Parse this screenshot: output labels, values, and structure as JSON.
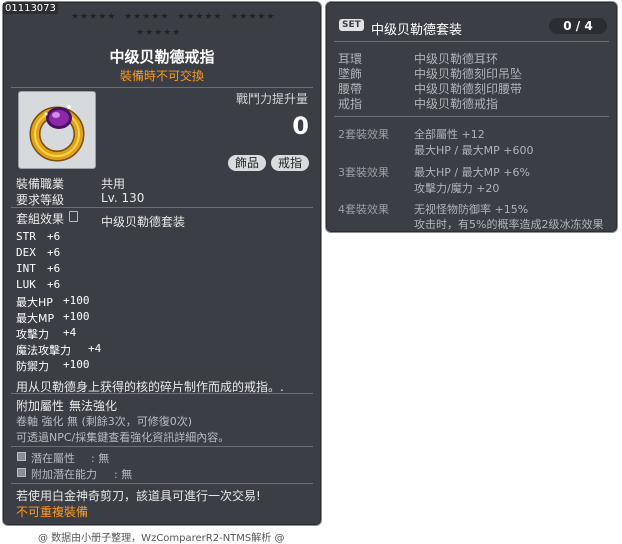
{
  "item": {
    "id": "01113073",
    "title": "中级贝勒德戒指",
    "trade_note": "裝備時不可交換",
    "power_label": "戰鬥力提升量",
    "power_value": "0",
    "tags": [
      "飾品",
      "戒指"
    ],
    "job_label": "裝備職業",
    "job_value": "共用",
    "level_label": "要求等級",
    "level_value": "Lv. 130",
    "set_label": "套組效果",
    "set_value": "中级贝勒德套装",
    "stats": [
      {
        "name": "STR",
        "value": "+6"
      },
      {
        "name": "DEX",
        "value": "+6"
      },
      {
        "name": "INT",
        "value": "+6"
      },
      {
        "name": "LUK",
        "value": "+6"
      },
      {
        "name": "最大HP",
        "value": "+100"
      },
      {
        "name": "最大MP",
        "value": "+100"
      },
      {
        "name": "攻擊力",
        "value": "+4"
      },
      {
        "name": "魔法攻擊力",
        "value": "+4"
      },
      {
        "name": "防禦力",
        "value": "+100"
      }
    ],
    "description": "用从贝勒德身上获得的核的碎片制作而成的戒指。.",
    "extra_label": "附加屬性",
    "extra_value": "無法強化",
    "scroll_info": "卷軸 強化 無 (剩餘3次，可修復0次)",
    "scroll_hint": "可透過NPC/採集鍵查看強化資訊詳細內容。",
    "potential_label": "潛在屬性",
    "potential_value": ": 無",
    "add_potential_label": "附加潛在能力",
    "add_potential_value": ": 無",
    "scissors_note": "若使用白金神奇剪刀，該道具可進行一次交易!",
    "not_repeatable": "不可重複裝備"
  },
  "set_panel": {
    "badge": "SET",
    "name": "中级贝勒德套装",
    "count": "0 / 4",
    "parts": [
      {
        "slot": "耳環",
        "name": "中级贝勒德耳环"
      },
      {
        "slot": "墜飾",
        "name": "中级贝勒德刻印吊坠"
      },
      {
        "slot": "腰帶",
        "name": "中级贝勒德刻印腰带"
      },
      {
        "slot": "戒指",
        "name": "中级贝勒德戒指"
      }
    ],
    "bonuses": [
      {
        "label": "2套裝效果",
        "lines": [
          "全部屬性 +12",
          "最大HP / 最大MP +600"
        ]
      },
      {
        "label": "3套裝效果",
        "lines": [
          "最大HP / 最大MP +6%",
          "攻擊力/魔力 +20"
        ]
      },
      {
        "label": "4套裝效果",
        "lines": [
          "无视怪物防御率 +15%",
          "攻击时，有5%的概率造成2级冰冻效果"
        ]
      }
    ]
  },
  "footer": "@ 数据由小册子整理，WzComparerR2-NTMS解析 @",
  "colors": {
    "panel_bg": "#3b3f45",
    "orange": "#ff9a1e",
    "ring_gold": "#e0a21a",
    "gem_purple": "#8a2aa8"
  }
}
